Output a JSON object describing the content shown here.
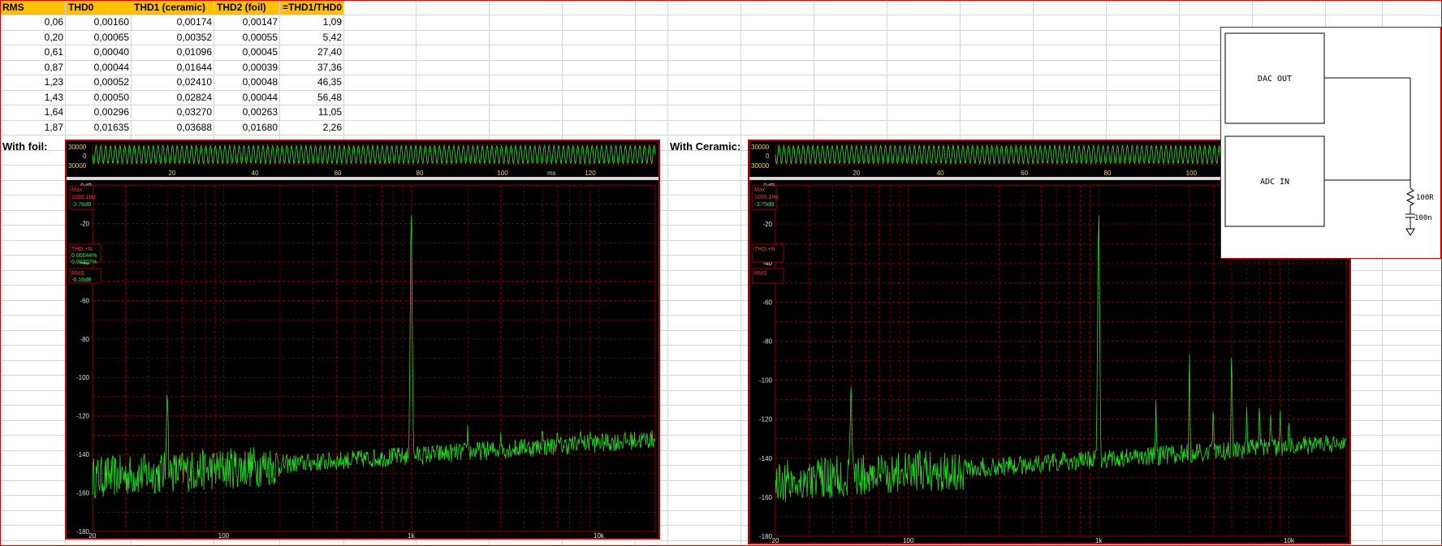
{
  "sheet": {
    "headers": [
      "RMS",
      "THD0",
      "THD1 (ceramic)",
      "THD2 (foil)",
      "=THD1/THD0"
    ],
    "rows": [
      [
        "0,06",
        "0,00160",
        "0,00174",
        "0,00147",
        "1,09"
      ],
      [
        "0,20",
        "0,00065",
        "0,00352",
        "0,00055",
        "5,42"
      ],
      [
        "0,61",
        "0,00040",
        "0,01096",
        "0,00045",
        "27,40"
      ],
      [
        "0,87",
        "0,00044",
        "0,01644",
        "0,00039",
        "37,36"
      ],
      [
        "1,23",
        "0,00052",
        "0,02410",
        "0,00048",
        "46,35"
      ],
      [
        "1,43",
        "0,00050",
        "0,02824",
        "0,00044",
        "56,48"
      ],
      [
        "1,64",
        "0,00296",
        "0,03270",
        "0,00263",
        "11,05"
      ],
      [
        "1,87",
        "0,01635",
        "0,03688",
        "0,01680",
        "2,26"
      ]
    ],
    "label_foil": "With foil:",
    "label_ceramic": "With Ceramic:"
  },
  "scope_common": {
    "wave_y_ticks": [
      "30000",
      "0",
      "30000"
    ],
    "wave_x_ticks": [
      "20",
      "40",
      "60",
      "80",
      "100",
      "120"
    ],
    "wave_x_unit": "ms",
    "spec_y_ticks": [
      "0dB",
      "-20",
      "-40",
      "-60",
      "-80",
      "-100",
      "-120",
      "-140",
      "-160",
      "-180"
    ],
    "spec_x_ticks": [
      "20",
      "100",
      "1k",
      "10k"
    ]
  },
  "scope_foil": {
    "max_label": "Max",
    "max_freq": "1000.1Hz",
    "max_db": "-3.78dB",
    "thd_label": "THD,+N",
    "thd_value1": "0.00044%",
    "thd_value2": "0.00327%",
    "rms_label": "RMS",
    "rms_value": "-6.16dB"
  },
  "scope_ceramic": {
    "max_label": "Max",
    "max_freq": "1000.1Hz",
    "max_db": "-3.79dB",
    "thd_label": "THD,+N",
    "rms_label": "RMS"
  },
  "schematic": {
    "dac_label": "DAC OUT",
    "adc_label": "ADC IN",
    "resistor_label": "100R",
    "capacitor_label": "100n"
  },
  "colors": {
    "header_fill": "#ffc000",
    "trace": "#22dd22",
    "scope_border": "#c00000",
    "grid": "#b00000"
  }
}
